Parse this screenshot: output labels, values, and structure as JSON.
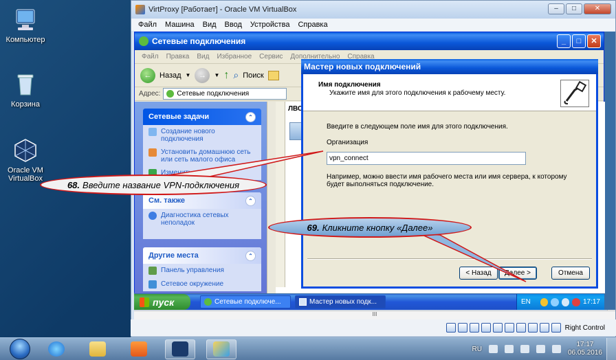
{
  "desktop": {
    "icons": [
      {
        "label": "Компьютер"
      },
      {
        "label": "Корзина"
      },
      {
        "label": "Oracle VM VirtualBox"
      }
    ]
  },
  "vbox": {
    "title": "VirtProxy [Работает] - Oracle VM VirtualBox",
    "menu": [
      "Файл",
      "Машина",
      "Вид",
      "Ввод",
      "Устройства",
      "Справка"
    ],
    "hscroll_glyph": "III",
    "status_right": "Right Control"
  },
  "explorer": {
    "title": "Сетевые подключения",
    "menu": [
      "Файл",
      "Правка",
      "Вид",
      "Избранное",
      "Сервис",
      "Дополнительно",
      "Справка"
    ],
    "back_label": "Назад",
    "search_label": "Поиск",
    "address_label": "Адрес:",
    "address_value": "Сетевые подключения",
    "column_header": "ЛВС",
    "network_tasks": {
      "title": "Сетевые задачи",
      "items": [
        "Создание нового подключения",
        "Установить домашнюю сеть или сеть малого офиса",
        "Изменить пара..."
      ]
    },
    "see_also": {
      "title": "См. также",
      "items": [
        "Диагностика сетевых неполадок"
      ]
    },
    "other_places": {
      "title": "Другие места",
      "items": [
        "Панель управления",
        "Сетевое окружение"
      ]
    }
  },
  "wizard": {
    "title": "Мастер новых подключений",
    "header_title": "Имя подключения",
    "header_subtitle": "Укажите имя для этого подключения к рабочему месту.",
    "instruction": "Введите в следующем поле имя для этого подключения.",
    "field_label": "Организация",
    "field_value": "vpn_connect",
    "hint_line1": "Например, можно ввести имя рабочего места или имя сервера, к которому",
    "hint_line2": "будет выполняться подключение.",
    "back_button": "< Назад",
    "next_button": "Далее >",
    "cancel_button": "Отмена"
  },
  "guest_taskbar": {
    "start_label": "пуск",
    "tasks": [
      "Сетевые подключе...",
      "Мастер новых подк..."
    ],
    "lang": "EN",
    "time": "17:17"
  },
  "host_taskbar": {
    "lang": "RU",
    "time": "17:17",
    "date": "06.05.2016"
  },
  "callouts": {
    "step68_number": "68.",
    "step68_text": "Введите название VPN-подключения",
    "step69_number": "69.",
    "step69_text": "Кликните кнопку «Далее»"
  },
  "colors": {
    "xp_blue": "#0a57d8",
    "callout_border": "#d01818",
    "xp_start_green": "#3c9a3c"
  }
}
